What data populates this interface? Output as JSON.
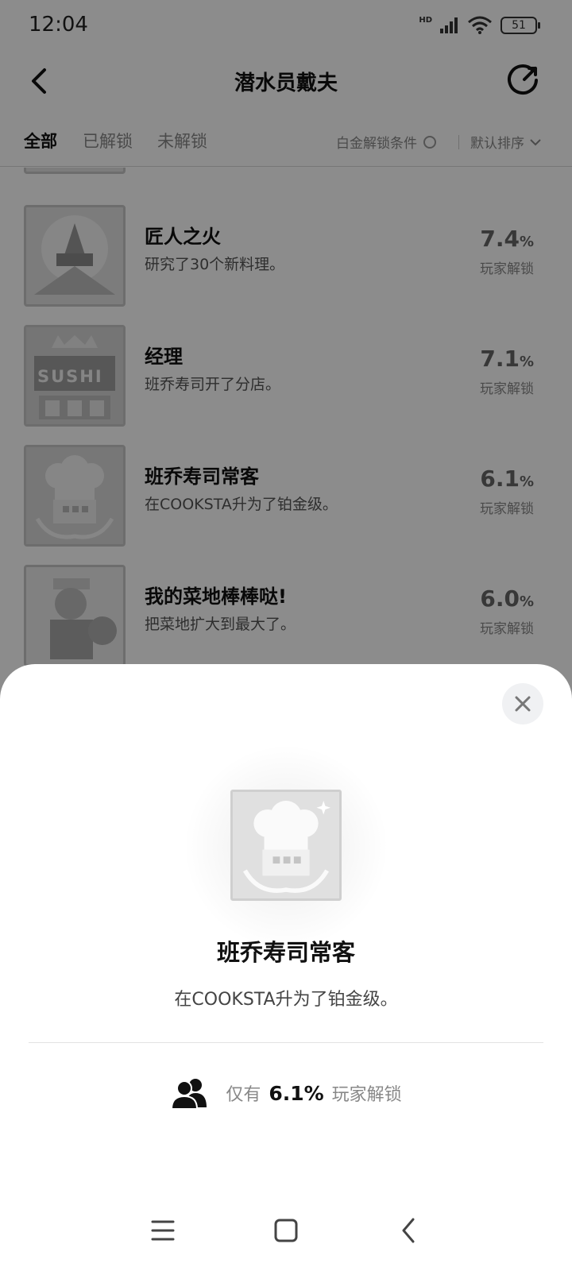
{
  "status_bar": {
    "time": "12:04",
    "battery": "51",
    "network": "HD"
  },
  "nav": {
    "title": "潜水员戴夫"
  },
  "tabs": [
    {
      "label": "全部",
      "active": true
    },
    {
      "label": "已解锁",
      "active": false
    },
    {
      "label": "未解锁",
      "active": false
    }
  ],
  "filter": {
    "platinum_label": "白金解锁条件",
    "sort_label": "默认排序"
  },
  "achievements": [
    {
      "title": "匠人之火",
      "desc": "研究了30个新料理。",
      "pct": "7.4",
      "unit": "%",
      "pct_label": "玩家解锁",
      "icon": "flame-emblem-icon"
    },
    {
      "title": "经理",
      "desc": "班乔寿司开了分店。",
      "pct": "7.1",
      "unit": "%",
      "pct_label": "玩家解锁",
      "icon": "sushi-shop-icon",
      "icon_text": "SUSHI"
    },
    {
      "title": "班乔寿司常客",
      "desc": "在COOKSTA升为了铂金级。",
      "pct": "6.1",
      "unit": "%",
      "pct_label": "玩家解锁",
      "icon": "chef-hat-icon"
    },
    {
      "title": "我的菜地棒棒哒!",
      "desc": "把菜地扩大到最大了。",
      "pct": "6.0",
      "unit": "%",
      "pct_label": "玩家解锁",
      "icon": "farmer-icon"
    }
  ],
  "sheet": {
    "title": "班乔寿司常客",
    "desc": "在COOKSTA升为了铂金级。",
    "unlock_prefix": "仅有",
    "unlock_pct": "6.1%",
    "unlock_suffix": "玩家解锁",
    "icon": "chef-hat-icon"
  },
  "colors": {
    "overlay": "#737373",
    "sheet_bg": "#ffffff",
    "close_bg": "#f0f1f3",
    "text_primary": "#111111",
    "text_muted": "#888888"
  }
}
